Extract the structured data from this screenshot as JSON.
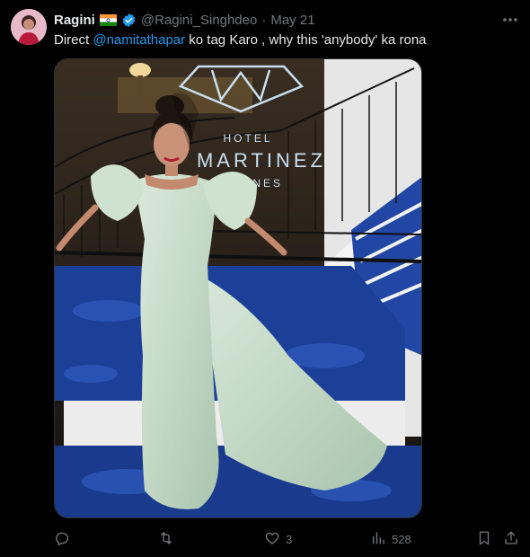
{
  "user": {
    "display_name": "Ragini",
    "handle": "@Ragini_Singhdeo",
    "separator": "·",
    "date": "May 21",
    "verified": true,
    "flag_icon": "india-flag-icon"
  },
  "post": {
    "text_prefix": "Direct ",
    "mention": "@namitathapar",
    "text_suffix": " ko tag Karo , why this 'anybody' ka rona"
  },
  "media": {
    "alt": "Woman in a pale mint off-shoulder gown with a long train posing on a staircase at Hotel Martinez Cannes",
    "sign_lines": [
      "HOTEL",
      "MARTINEZ",
      "CANNES"
    ]
  },
  "actions": {
    "reply_count": "",
    "repost_count": "",
    "like_count": "3",
    "views_count": "528"
  },
  "colors": {
    "background": "#000000",
    "text": "#e7e9ea",
    "muted": "#71767b",
    "accent": "#1d9bf0"
  }
}
